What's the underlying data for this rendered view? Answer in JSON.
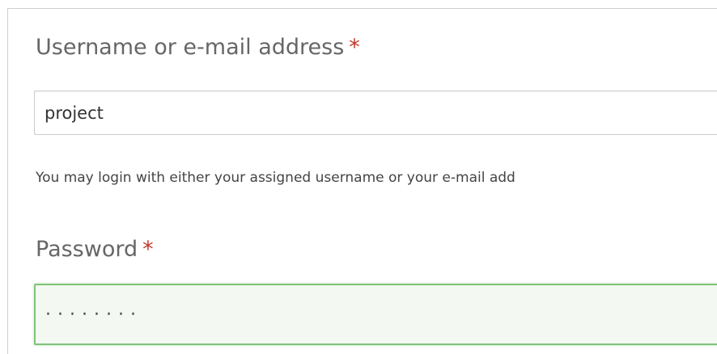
{
  "form": {
    "username": {
      "label": "Username or e-mail address",
      "required_marker": "*",
      "value": "project"
    },
    "help_text": "You may login with either your assigned username or your e-mail add",
    "password": {
      "label": "Password",
      "required_marker": "*",
      "masked_value": "········"
    }
  },
  "colors": {
    "required": "#c0392b",
    "focus_border": "#7fc37a",
    "focus_background": "#f3f8f2"
  }
}
